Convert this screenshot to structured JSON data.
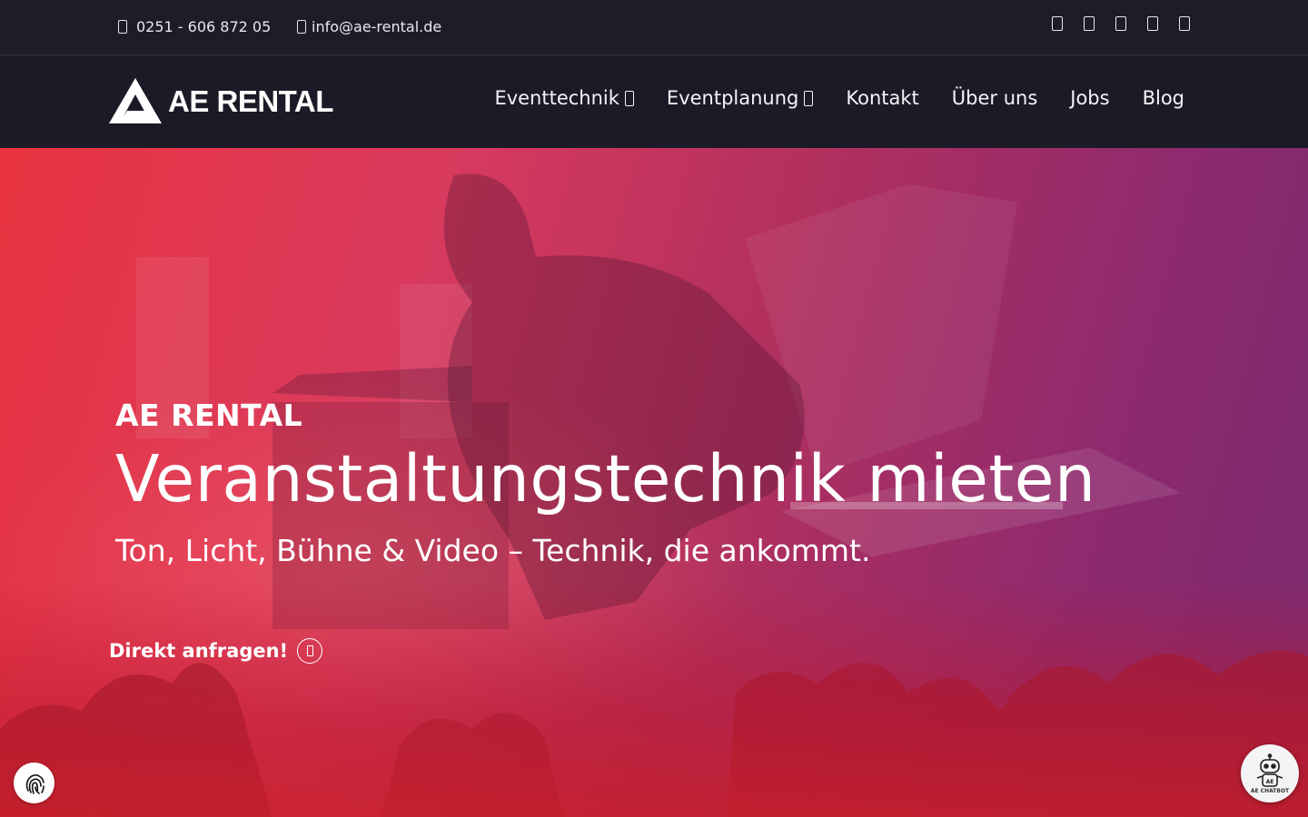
{
  "topbar": {
    "phone": "0251 - 606 872 05",
    "email": "info@ae-rental.de",
    "social_icons": [
      "facebook-icon",
      "instagram-icon",
      "linkedin-icon",
      "youtube-icon",
      "whatsapp-icon"
    ]
  },
  "header": {
    "logo_text": "AE RENTAL",
    "nav": [
      {
        "label": "Eventtechnik",
        "has_dropdown": true
      },
      {
        "label": "Eventplanung",
        "has_dropdown": true
      },
      {
        "label": "Kontakt",
        "has_dropdown": false
      },
      {
        "label": "Über uns",
        "has_dropdown": false
      },
      {
        "label": "Jobs",
        "has_dropdown": false
      },
      {
        "label": "Blog",
        "has_dropdown": false
      }
    ]
  },
  "hero": {
    "overline": "AE RENTAL",
    "title": "Veranstaltungstechnik mieten",
    "subtitle": "Ton, Licht, Bühne & Video – Technik, die ankommt.",
    "cta_label": "Direkt anfragen!",
    "cta_icon": "arrow-right-icon"
  },
  "chatbot": {
    "label": "AE CHATBOT",
    "badge": "AE"
  },
  "colors": {
    "topbar_bg": "#1c1d28",
    "nav_bg": "#1a1b26",
    "hero_red": "#e8333f",
    "hero_purple": "#7a2a6e"
  }
}
